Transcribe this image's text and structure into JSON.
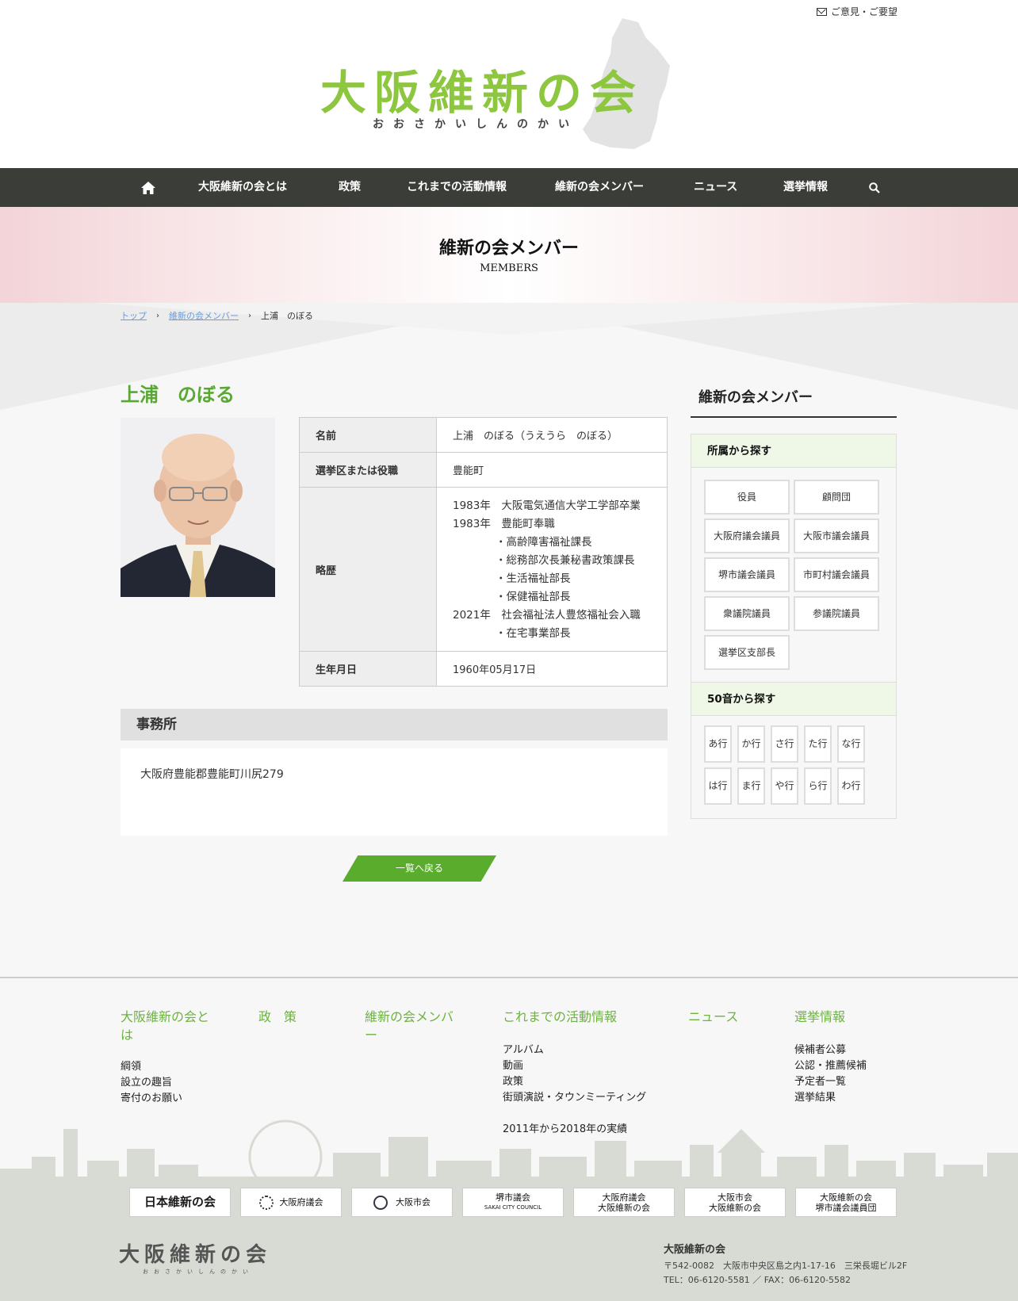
{
  "header": {
    "feedback_label": "ご意見・ご要望",
    "logo_main": "大阪維新の会",
    "logo_kana": "おおさかいしんのかい"
  },
  "nav": {
    "items": [
      {
        "icon": "home-icon"
      },
      {
        "label": "大阪維新の会とは"
      },
      {
        "label": "政策"
      },
      {
        "label": "これまでの活動情報"
      },
      {
        "label": "維新の会メンバー"
      },
      {
        "label": "ニュース"
      },
      {
        "label": "選挙情報"
      },
      {
        "icon": "search-icon"
      }
    ]
  },
  "page_title": {
    "ja": "維新の会メンバー",
    "en": "MEMBERS"
  },
  "breadcrumb": [
    "トップ",
    "維新の会メンバー",
    "上浦　のぼる"
  ],
  "member": {
    "name": "上浦　のぼる",
    "profile": {
      "name_label": "名前",
      "name_value": "上浦　のぼる（うえうら　のぼる）",
      "district_label": "選挙区または役職",
      "district_value": "豊能町",
      "career_label": "略歴",
      "career": [
        "1983年　大阪電気通信大学工学部卒業",
        "1983年　豊能町奉職",
        "　　　　・高齢障害福祉課長",
        "　　　　・総務部次長兼秘書政策課長",
        "　　　　・生活福祉部長",
        "　　　　・保健福祉部長",
        "2021年　社会福祉法人豊悠福祉会入職",
        "　　　　・在宅事業部長"
      ],
      "birth_label": "生年月日",
      "birth_value": "1960年05月17日"
    },
    "office_heading": "事務所",
    "office_address": "大阪府豊能郡豊能町川尻279",
    "back_label": "一覧へ戻る"
  },
  "sidebar": {
    "title": "維新の会メンバー",
    "affiliation_heading": "所属から探す",
    "affiliations": [
      "役員",
      "顧問団",
      "大阪府議会議員",
      "大阪市議会議員",
      "堺市議会議員",
      "市町村議会議員",
      "衆議院議員",
      "参議院議員",
      "選挙区支部長"
    ],
    "kana_heading": "50音から探す",
    "kana": [
      "あ行",
      "か行",
      "さ行",
      "た行",
      "な行",
      "は行",
      "ま行",
      "や行",
      "ら行",
      "わ行"
    ]
  },
  "footer": {
    "cols": [
      {
        "title": "大阪維新の会とは",
        "links": [
          "綱領",
          "設立の趣旨",
          "寄付のお願い"
        ]
      },
      {
        "title": "政　策",
        "links": []
      },
      {
        "title": "維新の会メンバー",
        "links": []
      },
      {
        "title": "これまでの活動情報",
        "links": [
          "アルバム",
          "動画",
          "政策",
          "街頭演説・タウンミーティング",
          "2011年から2018年の実績"
        ]
      },
      {
        "title": "ニュース",
        "links": []
      },
      {
        "title": "選挙情報",
        "links": [
          "候補者公募",
          "公認・推薦候補",
          "予定者一覧",
          "選挙結果"
        ]
      }
    ],
    "banners": [
      {
        "label": "日本維新の会"
      },
      {
        "label": "大阪府議会"
      },
      {
        "label": "大阪市会"
      },
      {
        "label": "堺市議会",
        "sub": "SAKAI CITY COUNCIL"
      },
      {
        "label": "大阪府議会",
        "sub": "大阪維新の会"
      },
      {
        "label": "大阪市会",
        "sub": "大阪維新の会"
      },
      {
        "label": "大阪維新の会",
        "sub": "堺市議会議員団"
      }
    ],
    "logo_main": "大阪維新の会",
    "logo_kana": "おおさかいしんのかい",
    "org": "大阪維新の会",
    "address": "〒542-0082　大阪市中央区島之内1-17-16　三栄長堀ビル2F",
    "contact": "TEL：06-6120-5581 ／ FAX：06-6120-5582"
  }
}
